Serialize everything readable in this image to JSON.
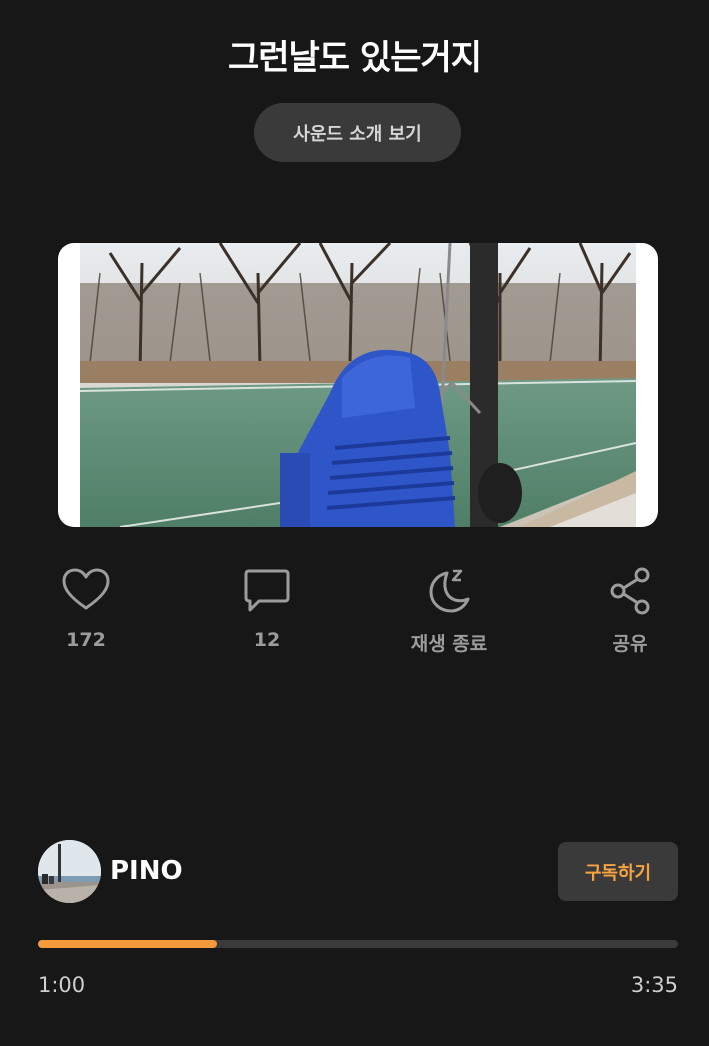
{
  "song": {
    "title": "그런날도 있는거지",
    "sound_intro_label": "사운드 소개 보기"
  },
  "actions": {
    "like": {
      "count": "172",
      "icon": "heart-icon"
    },
    "comment": {
      "count": "12",
      "icon": "speech-bubble-icon"
    },
    "sleep_timer": {
      "label": "재생 종료",
      "icon": "moon-sleep-icon"
    },
    "share": {
      "label": "공유",
      "icon": "share-icon"
    }
  },
  "artist": {
    "name": "PINO",
    "subscribe_label": "구독하기"
  },
  "player": {
    "current_time": "1:00",
    "total_time": "3:35",
    "progress": 0.28
  },
  "colors": {
    "background": "#171717",
    "accent": "#f49a3d",
    "button_bg": "#3a3a3a"
  }
}
